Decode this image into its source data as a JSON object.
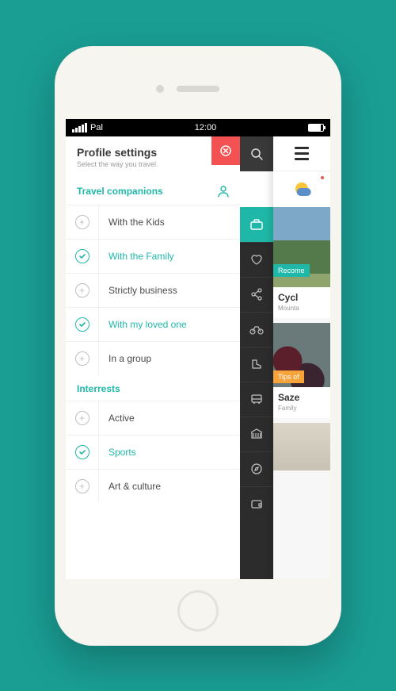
{
  "statusbar": {
    "carrier": "Pal",
    "time": "12:00"
  },
  "header": {
    "title": "Profile settings",
    "subtitle": "Select the way you travel."
  },
  "sections": {
    "companions": {
      "title": "Travel companions",
      "items": [
        {
          "label": "With the Kids",
          "selected": false
        },
        {
          "label": "With the Family",
          "selected": true
        },
        {
          "label": "Strictly business",
          "selected": false
        },
        {
          "label": "With my loved one",
          "selected": true
        },
        {
          "label": "In a group",
          "selected": false
        }
      ]
    },
    "interests": {
      "title": "Interrests",
      "items": [
        {
          "label": "Active",
          "selected": false
        },
        {
          "label": "Sports",
          "selected": true
        },
        {
          "label": "Art & culture",
          "selected": false
        }
      ]
    }
  },
  "rail": {
    "items": [
      {
        "name": "briefcase",
        "active": true
      },
      {
        "name": "heart",
        "active": false
      },
      {
        "name": "share",
        "active": false
      },
      {
        "name": "bicycle",
        "active": false
      },
      {
        "name": "boot",
        "active": false
      },
      {
        "name": "bus",
        "active": false
      },
      {
        "name": "museum",
        "active": false
      },
      {
        "name": "compass",
        "active": false
      },
      {
        "name": "wallet",
        "active": false
      }
    ]
  },
  "peek": {
    "cards": [
      {
        "tag": "Recome",
        "title": "Cycl",
        "subtitle": "Mounta",
        "tagColor": "teal"
      },
      {
        "tag": "Tips of",
        "title": "Saze",
        "subtitle": "Family",
        "tagColor": "orange"
      }
    ]
  },
  "colors": {
    "accent": "#1fb8a8",
    "danger": "#f45152",
    "orange": "#f6a43a"
  }
}
